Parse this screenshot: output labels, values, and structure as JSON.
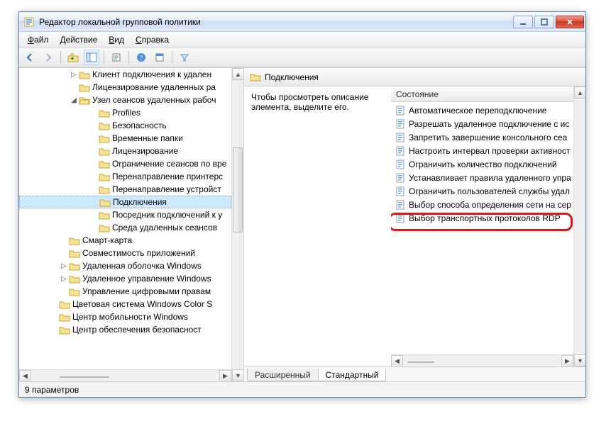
{
  "window": {
    "title": "Редактор локальной групповой политики"
  },
  "menu": {
    "file": "Файл",
    "action": "Действие",
    "view": "Вид",
    "help": "Справка"
  },
  "tree": {
    "n0": "Клиент подключения к удален",
    "n1": "Лицензирование удаленных ра",
    "n2": "Узел сеансов удаленных рабоч",
    "n3": "Profiles",
    "n4": "Безопасность",
    "n5": "Временные папки",
    "n6": "Лицензирование",
    "n7": "Ограничение сеансов по вре",
    "n8": "Перенаправление принтерс",
    "n9": "Перенаправление устройст",
    "n10": "Подключения",
    "n11": "Посредник подключений к у",
    "n12": "Среда удаленных сеансов",
    "n13": "Смарт-карта",
    "n14": "Совместимость приложений",
    "n15": "Удаленная оболочка Windows",
    "n16": "Удаленное управление Windows",
    "n17": "Управление цифровыми правам",
    "n18": "Цветовая система Windows Color S",
    "n19": "Центр мобильности Windows",
    "n20": "Центр обеспечения безопасност"
  },
  "right": {
    "header": "Подключения",
    "desc": "Чтобы просмотреть описание элемента, выделите его.",
    "column": "Состояние",
    "items": [
      "Автоматическое переподключение",
      "Разрешать удаленное подключение с ис",
      "Запретить завершение консольного сеа",
      "Настроить интервал проверки активност",
      "Ограничить количество подключений",
      "Устанавливает правила удаленного упра",
      "Ограничить пользователей службы удал",
      "Выбор способа определения сети на сер",
      "Выбор транспортных протоколов RDP"
    ],
    "tabs": {
      "ext": "Расширенный",
      "std": "Стандартный"
    }
  },
  "status": "9 параметров"
}
